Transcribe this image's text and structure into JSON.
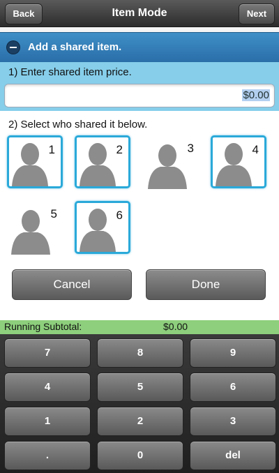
{
  "header": {
    "back_label": "Back",
    "title": "Item Mode",
    "next_label": "Next"
  },
  "section": {
    "title": "Add a shared item."
  },
  "step1": {
    "label": "1) Enter shared item price.",
    "price_value": "$0.00"
  },
  "step2": {
    "label": "2) Select who shared it below.",
    "people": [
      {
        "number": "1",
        "selected": true
      },
      {
        "number": "2",
        "selected": true
      },
      {
        "number": "3",
        "selected": false
      },
      {
        "number": "4",
        "selected": true
      },
      {
        "number": "5",
        "selected": false
      },
      {
        "number": "6",
        "selected": true
      }
    ]
  },
  "actions": {
    "cancel_label": "Cancel",
    "done_label": "Done"
  },
  "subtotal": {
    "label": "Running Subtotal:",
    "value": "$0.00"
  },
  "keypad": {
    "keys": [
      "7",
      "8",
      "9",
      "4",
      "5",
      "6",
      "1",
      "2",
      "3",
      ".",
      "0",
      "del"
    ]
  },
  "colors": {
    "header": "#2c2c2c",
    "section_bar": "#3a86c0",
    "step1_bg": "#86ceea",
    "selection": "#2aa9d9",
    "subtotal_bg": "#8dcf7c",
    "keypad_bg": "#2a2a2a"
  }
}
